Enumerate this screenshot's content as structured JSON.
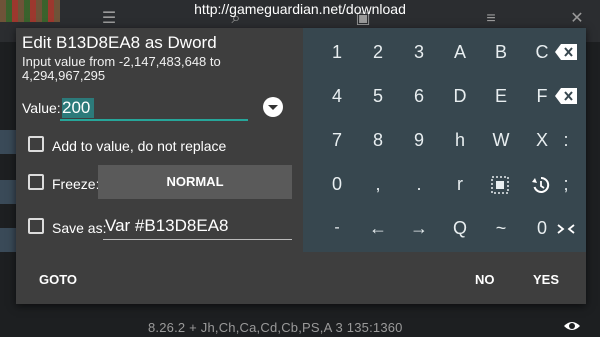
{
  "url_bar": {
    "text": "http://gameguardian.net/download"
  },
  "status_bar": {
    "text": "8.26.2  + Jh,Ch,Ca,Cd,Cb,PS,A  3  135:1360"
  },
  "dialog": {
    "title": "Edit B13D8EA8 as Dword",
    "hint": "Input value from -2,147,483,648 to 4,294,967,295",
    "value_label": "Value:",
    "value": "200",
    "add_label": "Add to value, do not replace",
    "freeze_label": "Freeze:",
    "freeze_mode": "NORMAL",
    "save_label": "Save as:",
    "save_value": "Var #B13D8EA8",
    "goto": "GOTO",
    "no": "NO",
    "yes": "YES"
  },
  "keypad": {
    "keys": [
      "1",
      "2",
      "3",
      "A",
      "B",
      "C",
      "4",
      "5",
      "6",
      "D",
      "E",
      "F",
      "7",
      "8",
      "9",
      "h",
      "W",
      "X",
      ":",
      "0",
      ",",
      ".",
      "r",
      ";",
      "-",
      "←",
      "→",
      "Q",
      "~",
      "0"
    ]
  },
  "colors": {
    "accent": "#26a69a",
    "keypad_bg": "#37474f",
    "dialog_bg": "#3e3e3e"
  }
}
